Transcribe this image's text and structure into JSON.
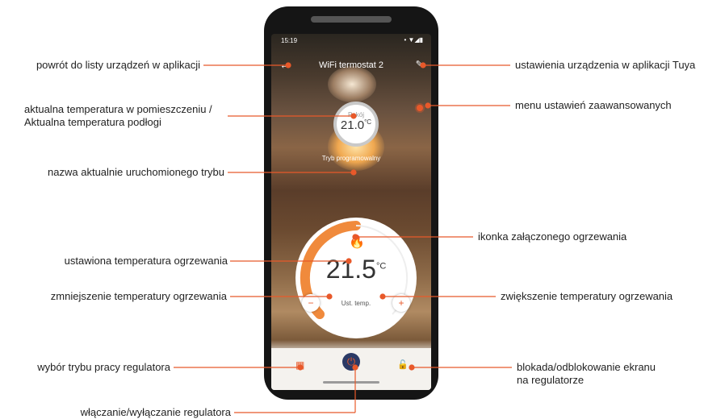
{
  "phone": {
    "status_time": "15:19",
    "status_dot": "•",
    "status_icons": "• ▼◢▮",
    "app_title": "WiFi termostat 2",
    "back_icon": "←",
    "edit_icon": "✎",
    "room_label": "Pokój",
    "room_temp": "21.0",
    "room_unit": "°C",
    "mode_name": "Tryb programowalny",
    "flame_icon": "🔥",
    "set_temp": "21.5",
    "set_unit": "°C",
    "set_label": "Ust. temp.",
    "minus_symbol": "−",
    "plus_symbol": "+",
    "grid_icon": "▦",
    "power_icon": "⏻",
    "lock_icon": "🔓"
  },
  "callouts": {
    "back": "powrót do listy urządzeń w aplikacji",
    "room_temp_line1": "aktualna temperatura w pomieszczeniu /",
    "room_temp_line2": "Aktualna temperatura podłogi",
    "mode": "nazwa aktualnie uruchomionego trybu",
    "set_temp": "ustawiona temperatura ogrzewania",
    "decrease": "zmniejszenie temperatury ogrzewania",
    "mode_select": "wybór trybu pracy regulatora",
    "power": "włączanie/wyłączanie regulatora",
    "settings": "ustawienia urządzenia w aplikacji Tuya",
    "advanced": "menu ustawień zaawansowanych",
    "heating_icon": "ikonka załączonego ogrzewania",
    "increase": "zwiększenie temperatury ogrzewania",
    "lock_line1": "blokada/odblokowanie ekranu",
    "lock_line2": "na regulatorze"
  },
  "colors": {
    "accent": "#e8592a",
    "dial_arc": "#f08a3c",
    "phone_body": "#151515"
  }
}
